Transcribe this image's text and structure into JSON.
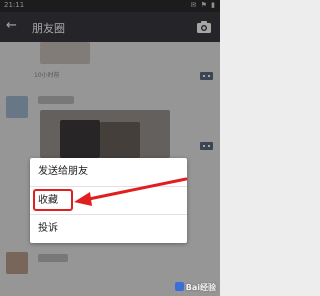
{
  "status_bar": {
    "time": "21:11",
    "icons": "✉ ⚑ ▮"
  },
  "app_bar": {
    "title": "朋友圈"
  },
  "feed": {
    "timestamp": "10小时前"
  },
  "context_menu": {
    "items": [
      {
        "label": "发送给朋友"
      },
      {
        "label": "收藏"
      },
      {
        "label": "投诉"
      }
    ]
  },
  "watermark": {
    "text": "Bai经验"
  },
  "colors": {
    "status_bar": "#2b2b2b",
    "app_bar": "#393a3f",
    "annotation_red": "#e02020"
  }
}
